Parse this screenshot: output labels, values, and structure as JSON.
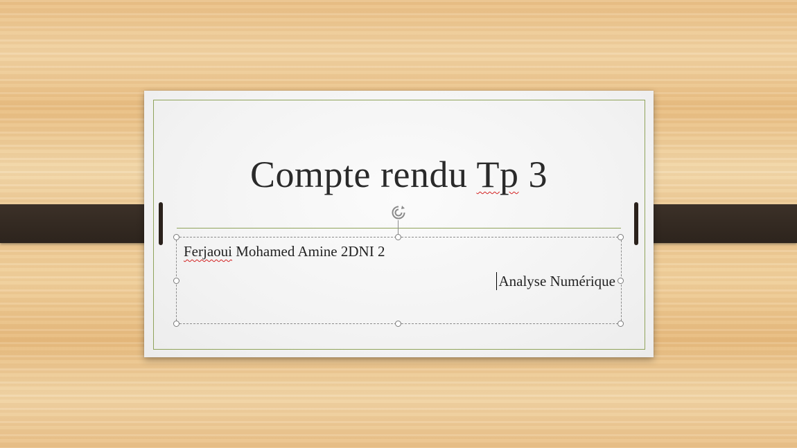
{
  "slide": {
    "title_main": "Compte rendu ",
    "title_flagged": "Tp",
    "title_end": " 3",
    "subtitle_line1_flagged": "Ferjaoui",
    "subtitle_line1_rest": " Mohamed Amine 2DNI 2",
    "subtitle_line2": "Analyse Numérique"
  },
  "icons": {
    "rotate": "rotate-handle-icon"
  },
  "colors": {
    "frame_accent": "#8fa35a",
    "strap": "#342a22",
    "spellcheck": "#d32020"
  }
}
